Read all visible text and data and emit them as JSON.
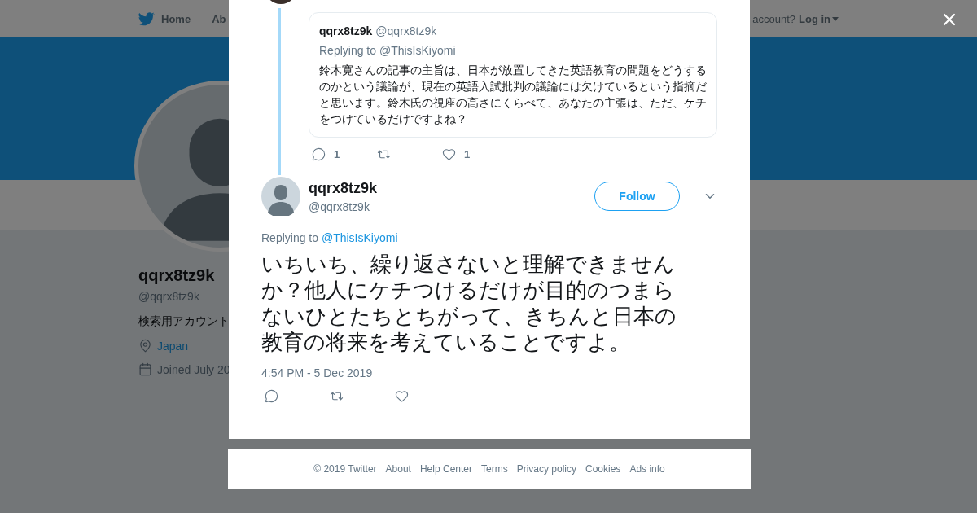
{
  "nav": {
    "items": [
      {
        "label": "Home",
        "kind": "home"
      },
      {
        "label": "Ab",
        "kind": "plain"
      }
    ],
    "account_prompt": "account?",
    "login": "Log in"
  },
  "profile": {
    "name": "qqrx8tz9k",
    "handle": "@qqrx8tz9k",
    "bio": "検索用アカウント",
    "location": "Japan",
    "joined": "Joined July 20"
  },
  "modal": {
    "parent": {
      "name": "qqrx8tz9k",
      "handle": "@qqrx8tz9k",
      "replying_prefix": "Replying to",
      "replying_to": "@ThisIsKiyomi",
      "text": "鈴木寛さんの記事の主旨は、日本が放置してきた英語教育の問題をどうするのかという議論が、現在の英語入試批判の議論には欠けているという指摘だと思います。鈴木氏の視座の高さにくらべて、あなたの主張は、ただ、ケチをつけているだけですよね？",
      "actions": [
        {
          "kind": "reply",
          "count": "1"
        },
        {
          "kind": "retweet"
        },
        {
          "kind": "like",
          "count": "1"
        }
      ]
    },
    "tweet": {
      "name": "qqrx8tz9k",
      "handle": "@qqrx8tz9k",
      "follow": "Follow",
      "replying_prefix": "Replying to",
      "replying_to": "@ThisIsKiyomi",
      "text": "いちいち、繰り返さないと理解できませんか？他人にケチつけるだけが目的のつまらないひとたちとちがって、きちんと日本の教育の将来を考えていることですよ。",
      "time": "4:54 PM - 5 Dec 2019",
      "actions": [
        {
          "kind": "reply"
        },
        {
          "kind": "retweet"
        },
        {
          "kind": "like"
        }
      ]
    }
  },
  "footer": [
    "© 2019 Twitter",
    "About",
    "Help Center",
    "Terms",
    "Privacy policy",
    "Cookies",
    "Ads info"
  ]
}
